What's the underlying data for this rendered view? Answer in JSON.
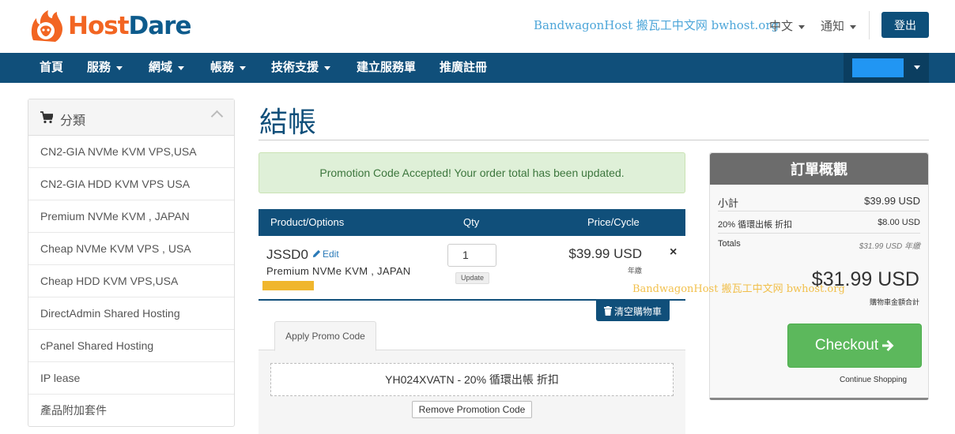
{
  "brand": {
    "logo_host": "Host",
    "logo_dare": "Dare",
    "primary_color": "#104f7a",
    "accent_color": "#f26522"
  },
  "header": {
    "watermark": "BandwagonHost 搬瓦工中文网 bwhost.org",
    "language_label": "中文",
    "notifications_label": "通知",
    "logout_label": "登出"
  },
  "navbar": {
    "items": [
      {
        "label": "首頁"
      },
      {
        "label": "服務"
      },
      {
        "label": "網域"
      },
      {
        "label": "帳務"
      },
      {
        "label": "技術支援"
      },
      {
        "label": "建立服務單"
      },
      {
        "label": "推廣註冊"
      }
    ]
  },
  "sidebar": {
    "title": "分類",
    "items": [
      {
        "label": "CN2-GIA NVMe KVM VPS,USA"
      },
      {
        "label": "CN2-GIA HDD KVM VPS USA"
      },
      {
        "label": "Premium NVMe KVM , JAPAN"
      },
      {
        "label": "Cheap NVMe KVM VPS , USA"
      },
      {
        "label": "Cheap HDD KVM VPS,USA"
      },
      {
        "label": "DirectAdmin Shared Hosting"
      },
      {
        "label": "cPanel Shared Hosting"
      },
      {
        "label": "IP lease"
      },
      {
        "label": "產品附加套件"
      }
    ]
  },
  "main": {
    "page_title": "結帳",
    "alert": "Promotion Code Accepted! Your order total has been updated.",
    "cart": {
      "columns": {
        "product": "Product/Options",
        "qty": "Qty",
        "price": "Price/Cycle"
      },
      "item": {
        "name": "JSSD0",
        "edit_label": "Edit",
        "group": "Premium NVMe KVM , JAPAN",
        "qty": "1",
        "update_label": "Update",
        "price": "$39.99 USD",
        "cycle": "年繳",
        "remove_label": "×"
      },
      "empty_cart_label": "清空購物車"
    },
    "promo": {
      "tab_label": "Apply Promo Code",
      "applied_code": "YH024XVATN - 20% 循環出帳 折扣",
      "remove_label": "Remove Promotion Code"
    }
  },
  "summary": {
    "title": "訂單概觀",
    "subtotal_label": "小計",
    "subtotal_value": "$39.99 USD",
    "discount_label": "20% 循環出帳 折扣",
    "discount_value": "$8.00 USD",
    "totals_label": "Totals",
    "totals_value": "$31.99 USD 年繳",
    "total_due": "$31.99 USD",
    "total_due_label": "購物車金額合計",
    "watermark": "BandwagonHost 搬瓦工中文网 bwhost.org",
    "checkout_label": "Checkout",
    "continue_label": "Continue Shopping"
  }
}
